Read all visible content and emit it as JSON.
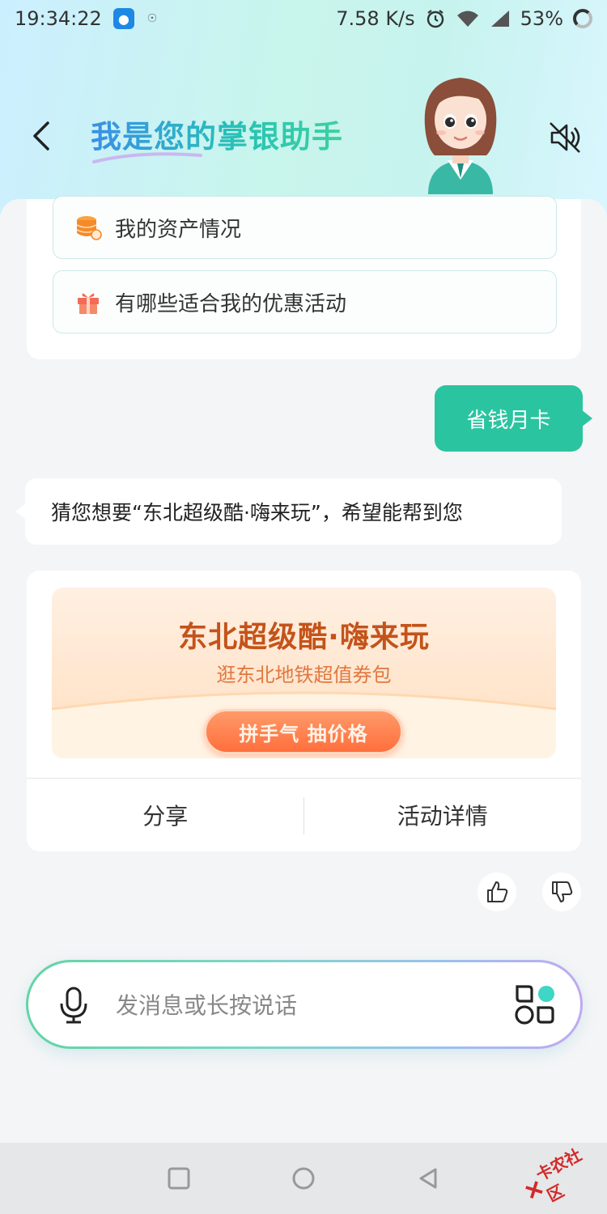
{
  "status_bar": {
    "time": "19:34:22",
    "network_speed": "7.58 K/s",
    "battery": "53%"
  },
  "header": {
    "title": "我是您的掌银助手"
  },
  "questions": [
    {
      "label": "我的资产情况",
      "icon": "database-coin-icon"
    },
    {
      "label": "有哪些适合我的优惠活动",
      "icon": "gift-icon"
    }
  ],
  "user_message": "省钱月卡",
  "bot_message": "猜您想要“东北超级酷·嗨来玩”，希望能帮到您",
  "promo": {
    "title": "东北超级酷·嗨来玩",
    "subtitle": "逛东北地铁超值券包",
    "button": "拼手气 抽价格",
    "share": "分享",
    "details": "活动详情"
  },
  "input": {
    "placeholder": "发消息或长按说话"
  },
  "watermark": "卡农社区",
  "colors": {
    "accent_green": "#2bc4a0",
    "promo_orange": "#c4531a"
  }
}
